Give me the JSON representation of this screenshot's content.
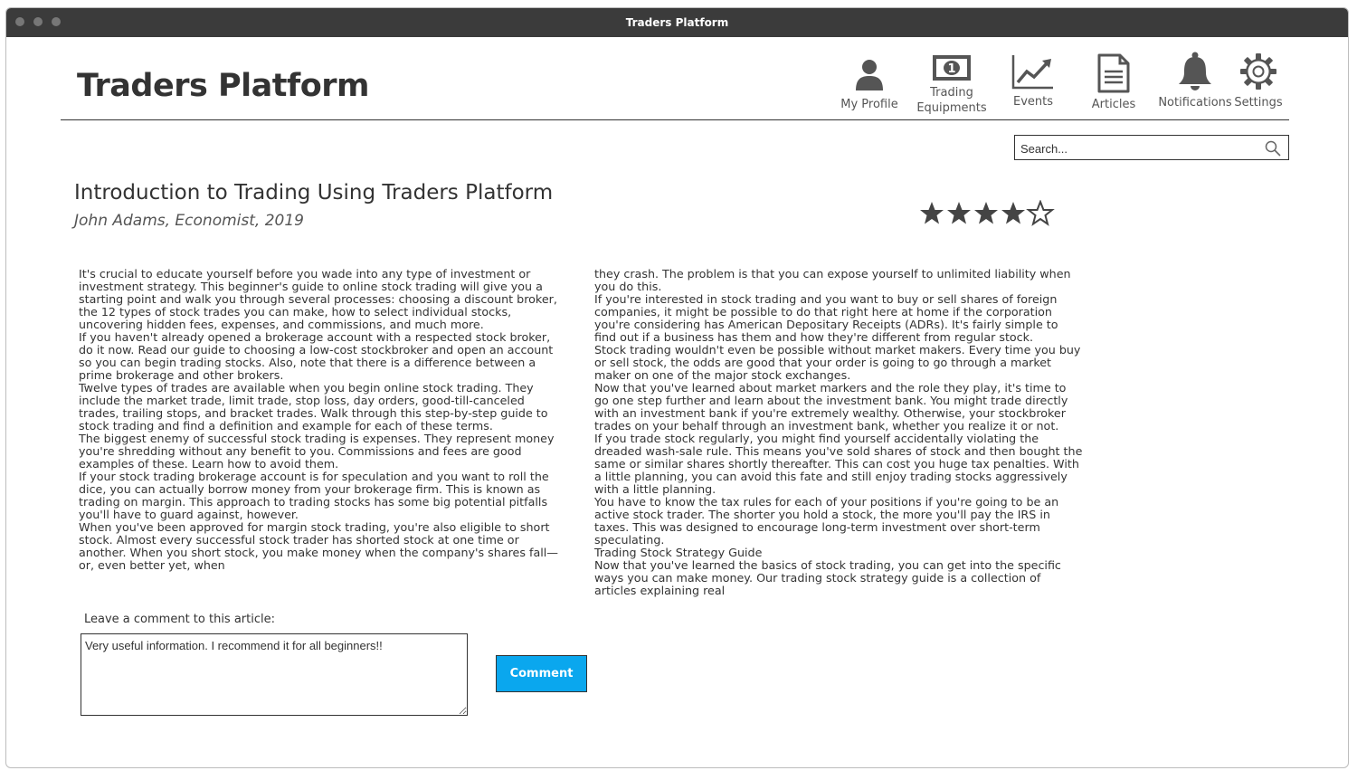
{
  "window": {
    "title": "Traders Platform"
  },
  "app": {
    "title": "Traders Platform"
  },
  "nav": [
    {
      "label": "My Profile"
    },
    {
      "label": "Trading\nEquipments"
    },
    {
      "label": "Events"
    },
    {
      "label": "Articles"
    },
    {
      "label": "Notifications"
    },
    {
      "label": "Settings"
    }
  ],
  "search": {
    "placeholder": "Search..."
  },
  "article": {
    "title": "Introduction to Trading Using Traders Platform",
    "byline": "John Adams, Economist, 2019",
    "rating": {
      "value": 4.5,
      "max": 5,
      "color": "#444444"
    },
    "column1": [
      "It's crucial to educate yourself before you wade into any type of investment or investment strategy. This beginner's guide to online stock trading will give you a starting point and walk you through several processes: choosing a discount broker, the 12 types of stock trades you can make, how to select individual stocks, uncovering hidden fees, expenses, and commissions, and much more.",
      "If you haven't already opened a brokerage account with a respected stock broker, do it now. Read our guide to choosing a low-cost stockbroker and open an account so you can begin trading stocks. Also, note that there is a difference between a prime brokerage and other brokers.",
      "Twelve types of trades are available when you begin online stock trading. They include the market trade, limit trade, stop loss, day orders, good-till-canceled trades, trailing stops, and bracket trades. Walk through this step-by-step guide to stock trading and find a definition and example for each of these terms.",
      "The biggest enemy of successful stock trading is expenses. They represent money you're shredding without any benefit to you. Commissions and fees are good examples of these. Learn how to avoid them.",
      "If your stock trading brokerage account is for speculation and you want to roll the dice, you can actually borrow money from your brokerage firm. This is known as trading on margin. This approach to trading stocks has some big potential pitfalls you'll have to guard against, however.",
      "When you've been approved for margin stock trading, you're also eligible to short stock. Almost every successful stock trader has shorted stock at one time or another. When you short stock, you make money when the company's shares fall—or, even better yet, when"
    ],
    "column2": [
      "they crash. The problem is that you can expose yourself to unlimited liability when you do this.",
      "If you're interested in stock trading and you want to buy or sell shares of foreign companies, it might be possible to do that right here at home if the corporation you're considering has American Depositary Receipts (ADRs). It's fairly simple to find out if a business has them and how they're different from regular stock.",
      "Stock trading wouldn't even be possible without market makers. Every time you buy or sell stock, the odds are good that your order is going to go through a market maker on one of the major stock exchanges.",
      "Now that you've learned about market markers and the role they play, it's time to go one step further and learn about the investment bank. You might trade directly with an investment bank if you're extremely wealthy. Otherwise, your stockbroker trades on your behalf through an investment bank, whether you realize it or not.",
      "If you trade stock regularly, you might find yourself accidentally violating the dreaded wash-sale rule. This means you've sold shares of stock and then bought the same or similar shares shortly thereafter. This can cost you huge tax penalties. With a little planning, you can avoid this fate and still enjoy trading stocks aggressively with a little planning.",
      "You have to know the tax rules for each of your positions if you're going to be an active stock trader. The shorter you hold a stock, the more you'll pay the IRS in taxes. This was designed to encourage long-term investment over short-term speculating.",
      "Trading Stock Strategy Guide",
      "Now that you've learned the basics of stock trading, you can get into the specific ways you can make money. Our trading stock strategy guide is a collection of articles explaining real"
    ]
  },
  "comment": {
    "label": "Leave a comment to this article:",
    "value": "Very useful information. I recommend it for all beginners!!",
    "button": "Comment",
    "button_color": "#0aa7ee"
  }
}
